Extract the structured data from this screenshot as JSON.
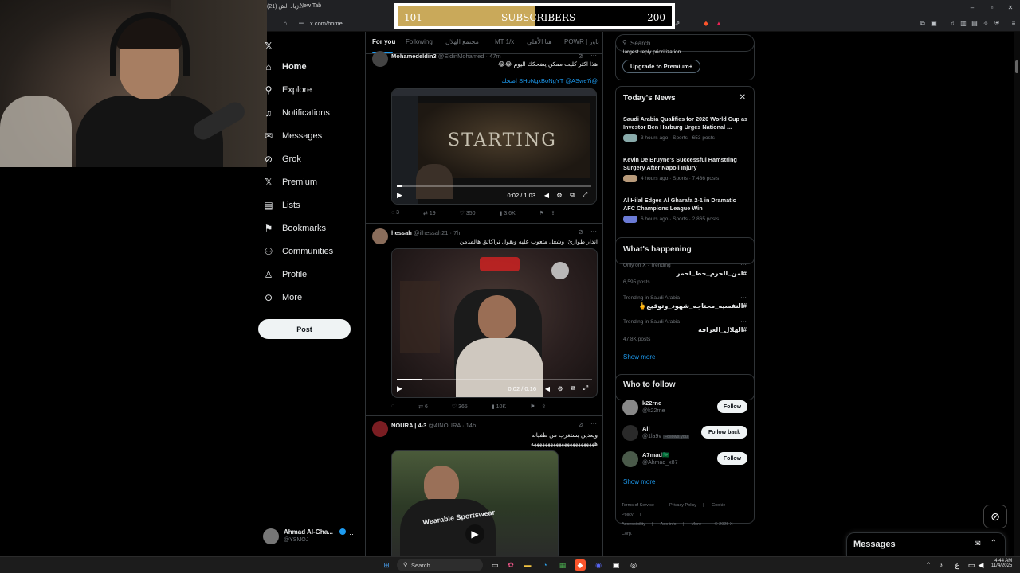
{
  "browser": {
    "tab_label": "(21) زياد الش...",
    "new_tab_label": "New Tab",
    "url": "x.com/home"
  },
  "overlay": {
    "sub_min": "101",
    "sub_label": "SUBSCRIBERS",
    "sub_max": "200",
    "sub_progress_fraction": 0.5
  },
  "nav": {
    "items": [
      {
        "label": "Home",
        "icon": "home-icon"
      },
      {
        "label": "Explore",
        "icon": "search-icon"
      },
      {
        "label": "Notifications",
        "icon": "bell-icon"
      },
      {
        "label": "Messages",
        "icon": "mail-icon"
      },
      {
        "label": "Grok",
        "icon": "grok-icon"
      },
      {
        "label": "Premium",
        "icon": "x-icon"
      },
      {
        "label": "Lists",
        "icon": "list-icon"
      },
      {
        "label": "Bookmarks",
        "icon": "bookmark-icon"
      },
      {
        "label": "Communities",
        "icon": "people-icon"
      },
      {
        "label": "Profile",
        "icon": "person-icon"
      },
      {
        "label": "More",
        "icon": "more-circle-icon"
      }
    ],
    "post_label": "Post",
    "account_name": "Ahmad Al-Gha...",
    "account_handle": "@YSMOJ"
  },
  "feed": {
    "tabs": [
      "For you",
      "Following",
      "مجتمع الهلال",
      "MT 1/x",
      "هنا الأهلي",
      "POWR | باور"
    ],
    "posts": [
      {
        "name": "Mohamedeldin3",
        "handle": "@EldinMohamed · 47m",
        "text1": "هذا اكثر كليب ممكن يضحكك اليوم 😂😂",
        "text2": "@SHoNgxBoNgYT @ASwe7i اضحك",
        "media_text": "STARTING",
        "time": "0:02 / 1:03",
        "replies": "3",
        "reposts": "19",
        "likes": "350",
        "views": "3.6K"
      },
      {
        "name": "hessah",
        "handle": "@ilhessah21 · 7h",
        "text1": "انذار طوارئ، وشغل متعوب عليه ويقول تراكاتق هالمدمن",
        "media_text": "",
        "time": "0:02 / 0:16",
        "replies": "",
        "reposts": "6",
        "likes": "365",
        "views": "10K",
        "progress": 0.13
      },
      {
        "name": "NOURA | 4-3",
        "handle": "@4INOURA · 14h",
        "text1": "ويعدين يستغرب من طفيانه",
        "text2": "هههههههههههههههههههههههه",
        "media_text": "Wearable Sportswear"
      }
    ]
  },
  "right": {
    "search_placeholder": "Search",
    "premium_teaser": "largest reply prioritization.",
    "upgrade_label": "Upgrade to Premium+",
    "news_title": "Today's News",
    "news": [
      {
        "headline": "Saudi Arabia Qualifies for 2026 World Cup as Investor Ben Harburg Urges National ...",
        "meta": "3 hours ago · Sports · 653 posts"
      },
      {
        "headline": "Kevin De Bruyne's Successful Hamstring Surgery After Napoli Injury",
        "meta": "4 hours ago · Sports · 7,436 posts"
      },
      {
        "headline": "Al Hilal Edges Al Gharafa 2-1 in Dramatic AFC Champions League Win",
        "meta": "6 hours ago · Sports · 2,865 posts"
      }
    ],
    "happening_title": "What's happening",
    "trends": [
      {
        "context": "Only on X · Trending",
        "tag": "#امن_الحرم_خط_احمر",
        "count": "6,595 posts"
      },
      {
        "context": "Trending in Saudi Arabia",
        "tag": "#النفسيه_محتاجه_شهود_وتوقيع🖕",
        "count": ""
      },
      {
        "context": "Trending in Saudi Arabia",
        "tag": "#الهلال_الغرافه",
        "count": "47.8K posts"
      }
    ],
    "show_more": "Show more",
    "wtf_title": "Who to follow",
    "wtf": [
      {
        "name": "k22rne",
        "handle": "@k22rne",
        "button": "Follow"
      },
      {
        "name": "Ali",
        "handle": "@1la9v",
        "badge": "Follows you",
        "button": "Follow back"
      },
      {
        "name": "A7mad🇸🇦",
        "handle": "@Ahmad_x87",
        "button": "Follow"
      }
    ],
    "footer": [
      "Terms of Service",
      "|",
      "Privacy Policy",
      "|",
      "Cookie Policy",
      "|",
      "Accessibility",
      "|",
      "Ads info",
      "|",
      "More ···",
      "© 2025 X Corp."
    ]
  },
  "messages": {
    "title": "Messages"
  },
  "taskbar": {
    "search_label": "Search",
    "time": "4:44 AM",
    "date": "11/4/2025"
  }
}
